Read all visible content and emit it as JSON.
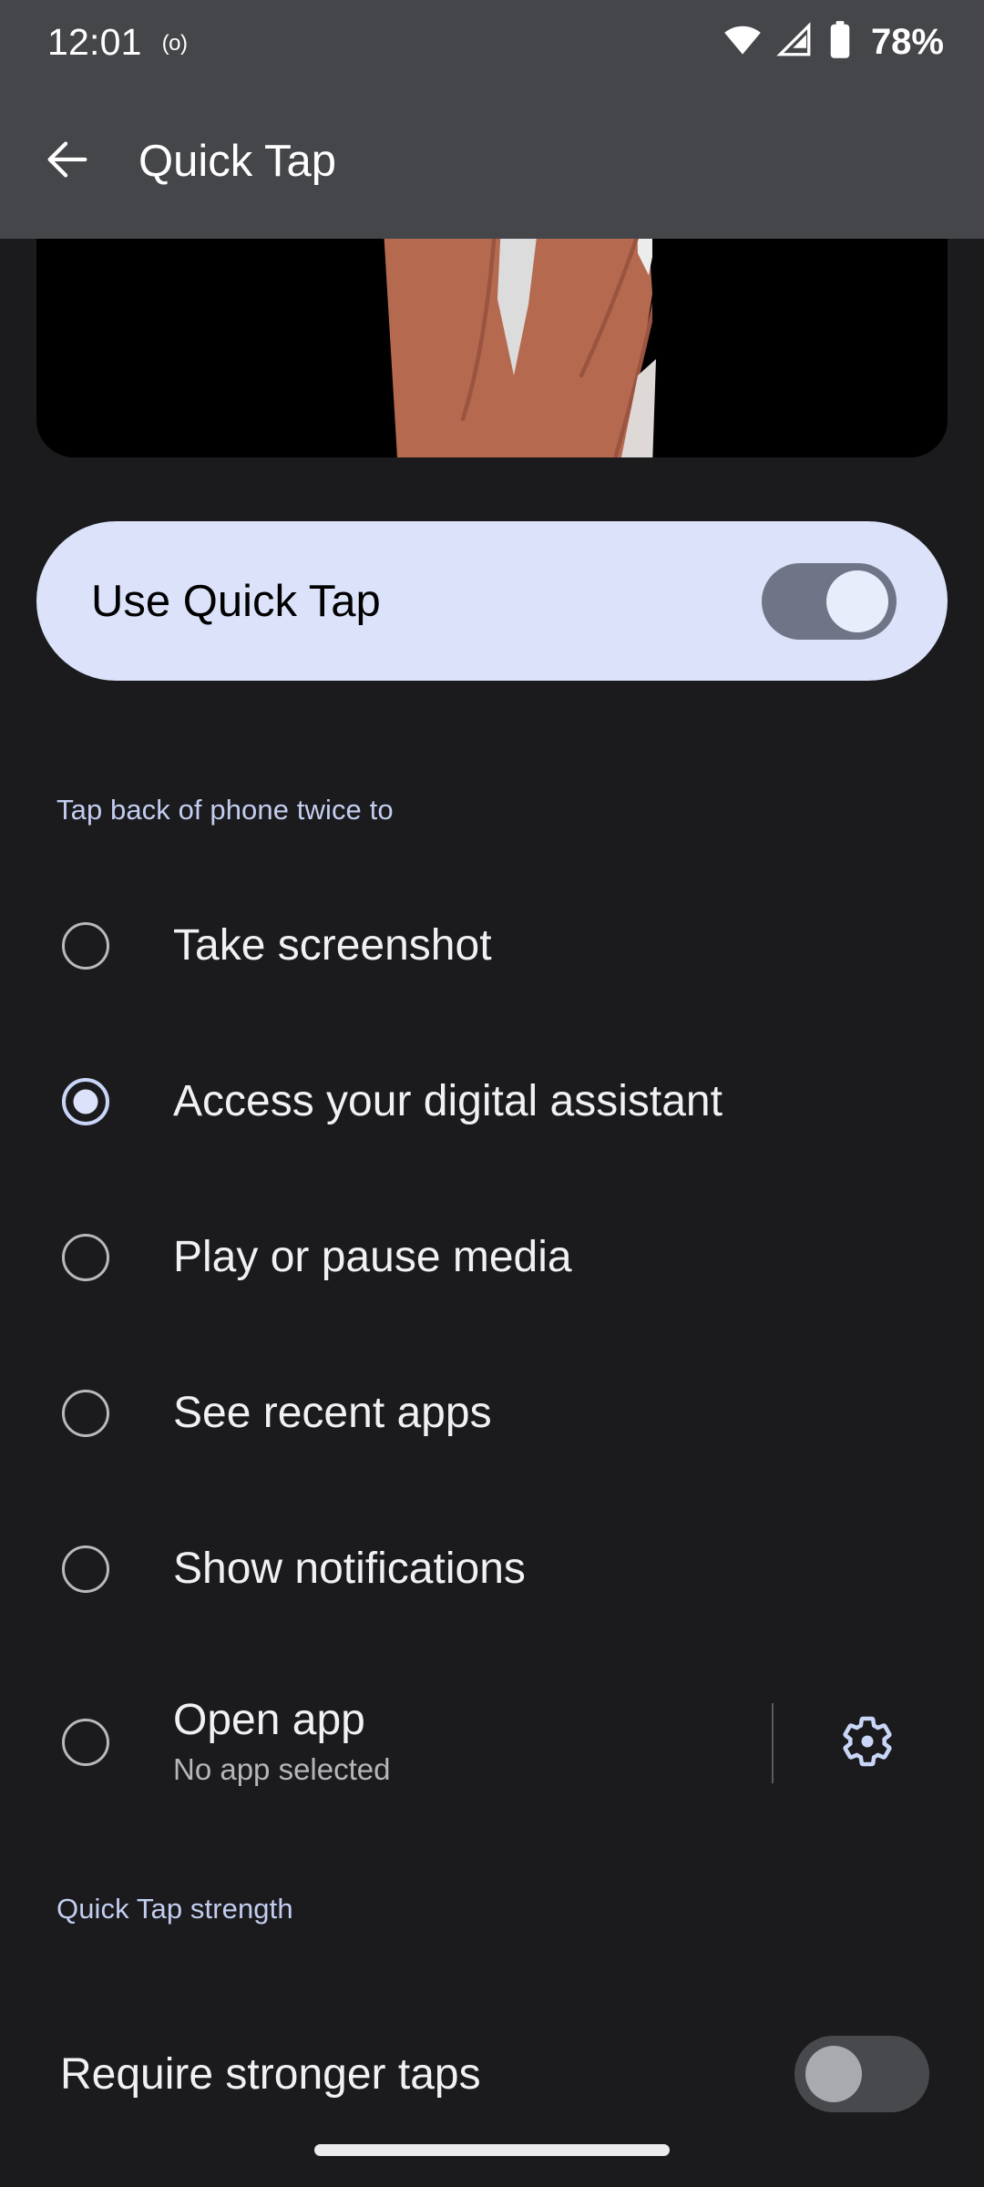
{
  "status_bar": {
    "time": "12:01",
    "dnd_indicator": "(o)",
    "battery_percent": "78%",
    "icons": [
      "wifi-icon",
      "cellular-signal-icon",
      "battery-icon"
    ]
  },
  "app_bar": {
    "back_label": "back-arrow-icon",
    "title": "Quick Tap"
  },
  "hero": {
    "alt": "illustration of a hand double-tapping the back of a phone",
    "background_color": "#000000",
    "skin_color": "#b56a50"
  },
  "main_toggle": {
    "label": "Use Quick Tap",
    "state": "on",
    "card_color": "#dbe2f9",
    "track_color": "#6f7586",
    "knob_color": "#e8edfb"
  },
  "action_section": {
    "header": "Tap back of phone twice to",
    "accent_color": "#c3cdf0",
    "options": [
      {
        "label": "Take screenshot",
        "selected": false,
        "subtitle": ""
      },
      {
        "label": "Access your digital assistant",
        "selected": true,
        "subtitle": ""
      },
      {
        "label": "Play or pause media",
        "selected": false,
        "subtitle": ""
      },
      {
        "label": "See recent apps",
        "selected": false,
        "subtitle": ""
      },
      {
        "label": "Show notifications",
        "selected": false,
        "subtitle": ""
      },
      {
        "label": "Open app",
        "selected": false,
        "subtitle": "No app selected"
      }
    ],
    "open_app_settings_icon": "gear-icon"
  },
  "strength_section": {
    "header": "Quick Tap strength",
    "toggle_label": "Require stronger taps",
    "toggle_state": "off",
    "track_color": "#48494d",
    "knob_color": "#a9aaae"
  },
  "navigation": {
    "home_pill": "gesture-home-indicator"
  }
}
